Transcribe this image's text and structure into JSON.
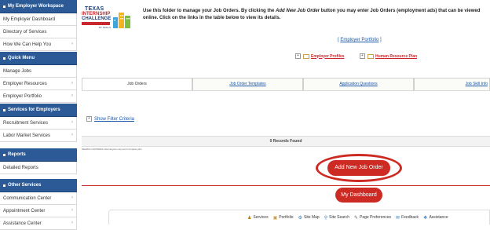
{
  "sidebar": {
    "sections": [
      {
        "header": "My Employer Workspace",
        "items": [
          {
            "label": "My Employer Dashboard",
            "arrow": false
          },
          {
            "label": "Directory of Services",
            "arrow": false
          },
          {
            "label": "How We Can Help You",
            "arrow": true
          }
        ]
      },
      {
        "header": "Quick Menu",
        "items": [
          {
            "label": "Manage Jobs",
            "arrow": false
          },
          {
            "label": "Employer Resources",
            "arrow": true
          },
          {
            "label": "Employer Portfolio",
            "arrow": true
          }
        ]
      },
      {
        "header": "Services for Employers",
        "items": [
          {
            "label": "Recruitment Services",
            "arrow": true
          },
          {
            "label": "Labor Market Services",
            "arrow": true
          }
        ]
      },
      {
        "header": "Reports",
        "items": [
          {
            "label": "Detailed Reports",
            "arrow": false
          }
        ]
      },
      {
        "header": "Other Services",
        "items": [
          {
            "label": "Communication Center",
            "arrow": true
          },
          {
            "label": "Appointment Center",
            "arrow": true
          },
          {
            "label": "Assistance Center",
            "arrow": true
          }
        ]
      }
    ]
  },
  "logo": {
    "line1": "TEXAS",
    "line2": "INTERNSHIP",
    "line3": "CHALLENGE",
    "line4": "BY SKILLS"
  },
  "intro": {
    "part1": "Use this folder to manage your Job Orders. By clicking the ",
    "italic": "Add New Job Order",
    "part2": " button you may enter Job Orders (employment ads) that can be viewed online. Click on the links in the table below to view its details."
  },
  "portfolio": {
    "link": "Employer Portfolio"
  },
  "profiles": {
    "employer_profiles": "Employer Profiles",
    "hr_plan": "Human Resource Plan"
  },
  "tabs": [
    {
      "label": "Job Orders",
      "active": true
    },
    {
      "label": "Job Order Templates",
      "active": false
    },
    {
      "label": "Application Questions",
      "active": false
    },
    {
      "label": "Job Skill Info",
      "active": false
    }
  ],
  "filter": {
    "label": "Show Filter Criteria"
  },
  "records": {
    "text": "0 Records Found"
  },
  "criteria": {
    "text": "SEARCH CRITERIA:Internal jobs only and Complete jobs"
  },
  "buttons": {
    "add_job": "Add New Job Order",
    "dashboard": "My Dashboard"
  },
  "footer": {
    "items": [
      {
        "icon": "services-icon",
        "label": "Services"
      },
      {
        "icon": "portfolio-icon",
        "label": "Portfolio"
      },
      {
        "icon": "sitemap-icon",
        "label": "Site Map"
      },
      {
        "icon": "search-icon",
        "label": "Site Search"
      },
      {
        "icon": "preferences-icon",
        "label": "Page Preferences"
      },
      {
        "icon": "feedback-icon",
        "label": "Feedback"
      },
      {
        "icon": "assistance-icon",
        "label": "Assistance"
      }
    ]
  },
  "colors": {
    "sidebar_header": "#2b5a96",
    "accent_red": "#cc2a22",
    "link_blue": "#1c58a8"
  }
}
